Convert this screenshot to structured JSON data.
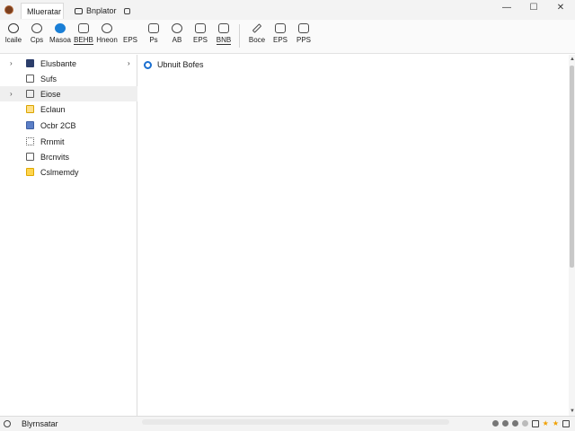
{
  "titlebar": {
    "active_tab": "Mlueratar",
    "other_tab": "Bnplator",
    "controls": {
      "minimize": "—",
      "maximize": "☐",
      "close": "✕"
    }
  },
  "toolbar": {
    "items": [
      {
        "label": "lcaile",
        "icon": "back-arrow-icon"
      },
      {
        "label": "Cps",
        "icon": "cloud-icon"
      },
      {
        "label": "Masoa",
        "icon": "play-circle-icon"
      },
      {
        "label": "BEHB",
        "icon": "link-icon"
      },
      {
        "label": "Hneon",
        "icon": "puzzle-icon"
      },
      {
        "label": "EPS",
        "icon": "blank-icon"
      },
      {
        "label": "Ps",
        "icon": "image-icon"
      },
      {
        "label": "AB",
        "icon": "tag-icon"
      },
      {
        "label": "EPS",
        "icon": "document-icon"
      },
      {
        "label": "BNB",
        "icon": "square-icon"
      },
      {
        "label": "Boce",
        "icon": "pencil-icon"
      },
      {
        "label": "EPS",
        "icon": "picture-icon"
      },
      {
        "label": "PPS",
        "icon": "grid-image-icon"
      }
    ]
  },
  "sidebar": {
    "items": [
      {
        "label": "Elusbante",
        "chevron": "›",
        "has_arrow": true,
        "icon": "dark-square-icon"
      },
      {
        "label": "Sufs",
        "chevron": "",
        "has_arrow": false,
        "icon": "list-icon"
      },
      {
        "label": "Eiose",
        "chevron": "›",
        "has_arrow": false,
        "icon": "list-icon"
      },
      {
        "label": "Eclaun",
        "chevron": "",
        "has_arrow": false,
        "icon": "yellow-folder-icon"
      },
      {
        "label": "Ocbr 2CB",
        "chevron": "",
        "has_arrow": false,
        "icon": "blue-square-icon"
      },
      {
        "label": "Rrnmit",
        "chevron": "",
        "has_arrow": false,
        "icon": "grid-icon"
      },
      {
        "label": "Brcnvits",
        "chevron": "",
        "has_arrow": false,
        "icon": "blank-icon"
      },
      {
        "label": "Cslmemdy",
        "chevron": "",
        "has_arrow": false,
        "icon": "folder-icon"
      }
    ]
  },
  "main": {
    "header": "Ubnuit Bofes"
  },
  "status": {
    "text": "Blyrnsatar",
    "right_icons": [
      "dot",
      "dot",
      "dot",
      "dot",
      "square",
      "star",
      "star",
      "square"
    ]
  },
  "colors": {
    "accent": "#1a7fd6",
    "selection": "#efefef",
    "titlebar": "#f3f3f3"
  }
}
